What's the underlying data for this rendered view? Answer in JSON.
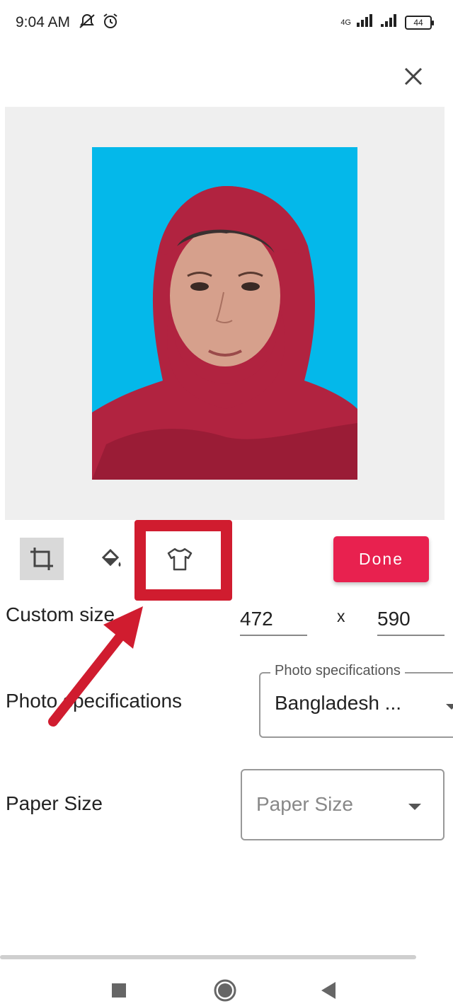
{
  "status_bar": {
    "time": "9:04 AM",
    "network": "4G",
    "battery": "44"
  },
  "toolbar": {
    "done_label": "Done",
    "accent_color": "#e8214f",
    "highlight_color": "#d01c2f"
  },
  "form": {
    "custom_size_label": "Custom size",
    "width_value": "472",
    "separator": "x",
    "height_value": "590",
    "photo_spec_label": "Photo specifications",
    "photo_spec_legend": "Photo specifications",
    "photo_spec_value": "Bangladesh ...",
    "paper_size_label": "Paper Size",
    "paper_size_placeholder": "Paper Size"
  },
  "photo": {
    "background_color": "#04b8ea",
    "scarf_color": "#b12340"
  }
}
